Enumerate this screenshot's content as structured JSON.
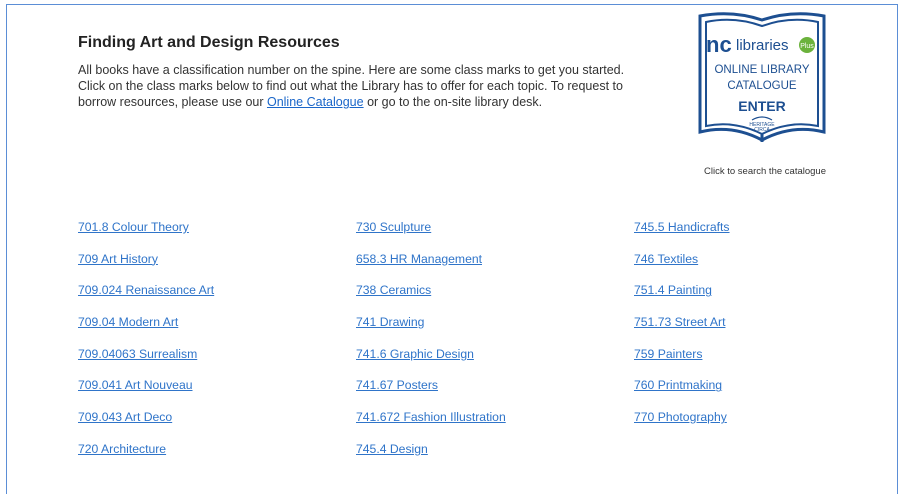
{
  "page": {
    "title": "Finding Art and Design Resources",
    "intro_before": "All books have a classification number on the spine. Here are some class marks to get you started. Click on the class marks below to find out what the Library has to offer for each topic. To request to borrow resources, please use our ",
    "intro_link": "Online Catalogue",
    "intro_after": " or go to the on-site library desk."
  },
  "catalogue": {
    "logo_nc": "nc",
    "logo_libraries": "libraries",
    "logo_badge": "Plus",
    "line1": "ONLINE LIBRARY",
    "line2": "CATALOGUE",
    "enter": "ENTER",
    "footer1": "HERITAGE",
    "footer2": "CIRCA",
    "caption": "Click to search the catalogue",
    "colors": {
      "border": "#1d4f91",
      "accent": "#6bb23c"
    }
  },
  "columns": [
    [
      "701.8  Colour Theory",
      "709  Art History",
      "709.024  Renaissance Art",
      "709.04  Modern Art",
      "709.04063 Surrealism",
      "709.041  Art Nouveau",
      "709.043  Art Deco",
      "720  Architecture"
    ],
    [
      "730  Sculpture",
      "658.3 HR Management",
      "738  Ceramics",
      "741  Drawing",
      "741.6  Graphic Design",
      "741.67  Posters",
      "741.672  Fashion Illustration",
      "745.4  Design"
    ],
    [
      "745.5  Handicrafts",
      "746  Textiles",
      "751.4  Painting",
      "751.73  Street Art",
      "759  Painters",
      "760  Printmaking",
      "770  Photography"
    ]
  ]
}
